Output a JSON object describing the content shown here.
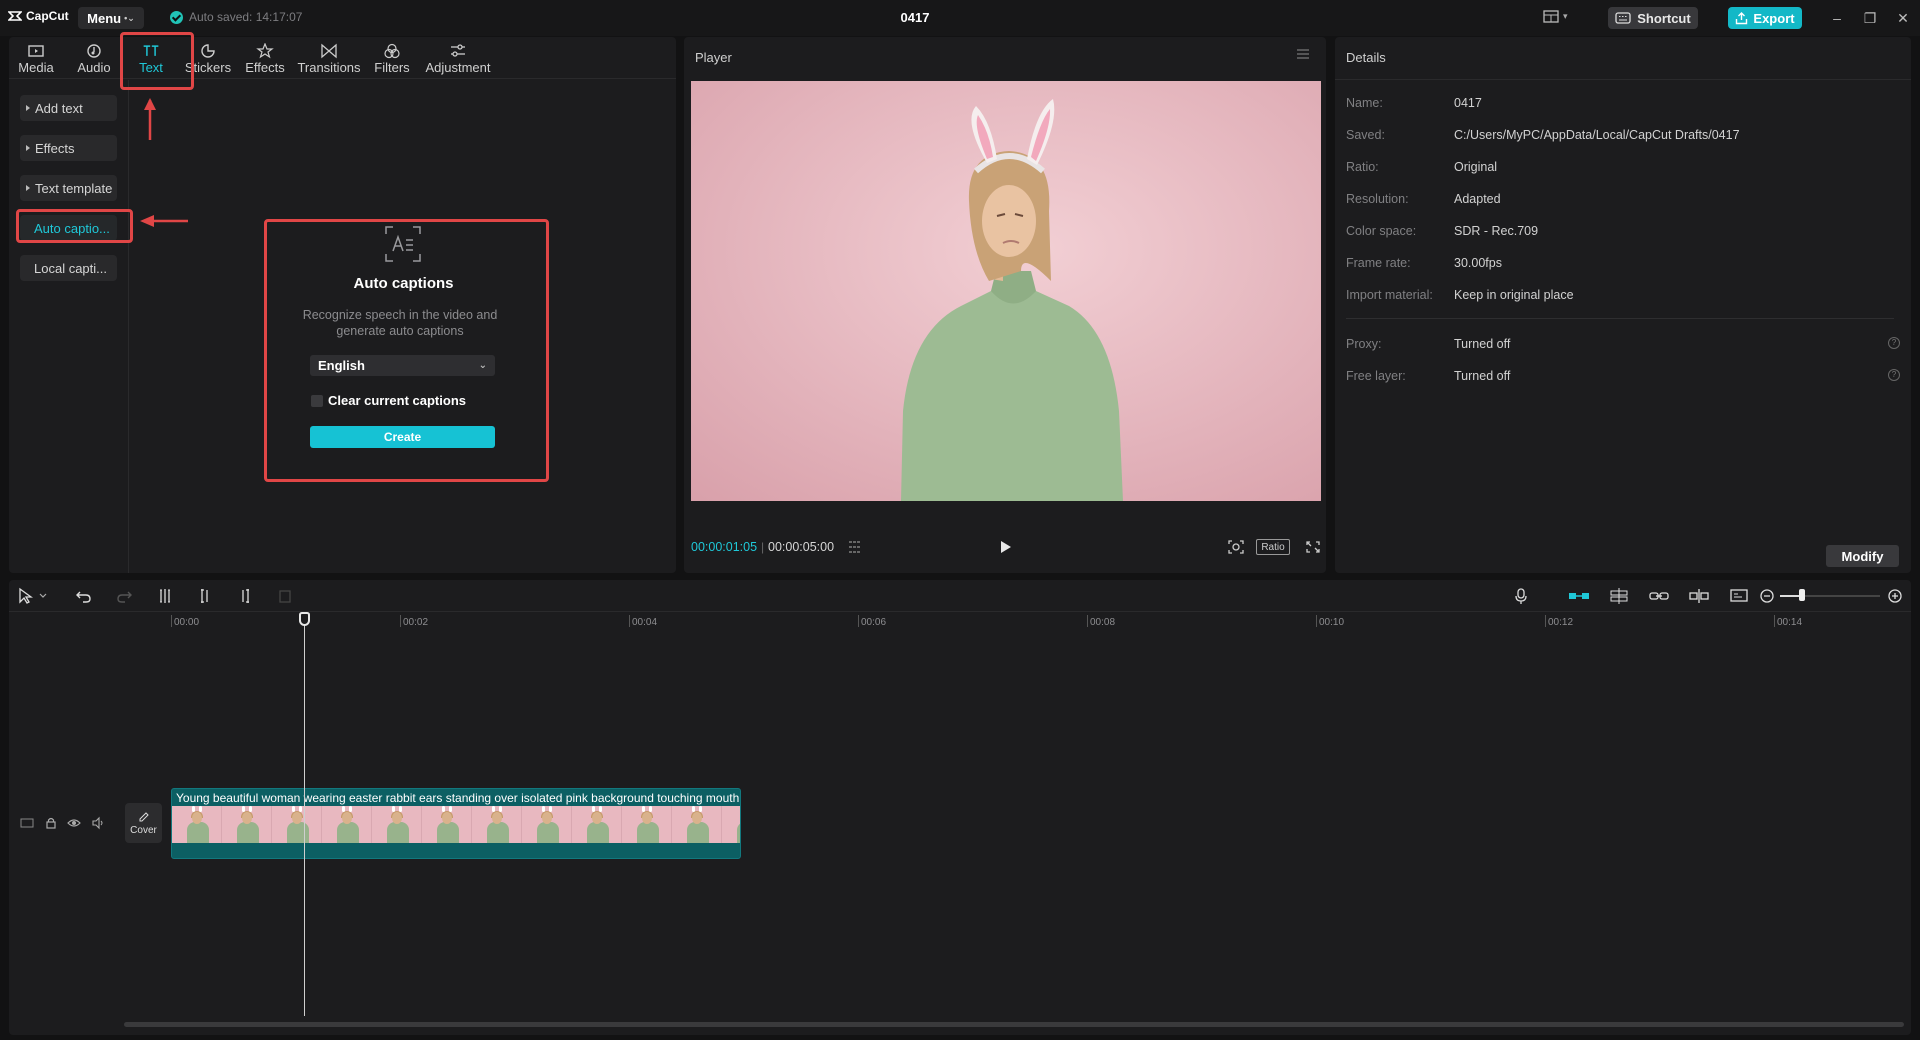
{
  "app": {
    "logo_text": "CapCut",
    "menu_label": "Menu",
    "autosave_text": "Auto saved: 14:17:07",
    "project_title": "0417",
    "shortcut_label": "Shortcut",
    "export_label": "Export"
  },
  "tabs": [
    {
      "label": "Media",
      "icon": "media-icon"
    },
    {
      "label": "Audio",
      "icon": "audio-icon"
    },
    {
      "label": "Text",
      "icon": "text-icon",
      "active": true
    },
    {
      "label": "Stickers",
      "icon": "stickers-icon"
    },
    {
      "label": "Effects",
      "icon": "effects-icon"
    },
    {
      "label": "Transitions",
      "icon": "transitions-icon"
    },
    {
      "label": "Filters",
      "icon": "filters-icon"
    },
    {
      "label": "Adjustment",
      "icon": "adjustment-icon"
    }
  ],
  "left_nav": [
    {
      "label": "Add text"
    },
    {
      "label": "Effects"
    },
    {
      "label": "Text template"
    },
    {
      "label": "Auto captio...",
      "active": true
    },
    {
      "label": "Local capti..."
    }
  ],
  "auto_captions": {
    "title": "Auto captions",
    "description": "Recognize speech in the video and generate auto captions",
    "language": "English",
    "clear_label": "Clear current captions",
    "create_label": "Create"
  },
  "player": {
    "title": "Player",
    "current_time": "00:00:01:05",
    "total_time": "00:00:05:00",
    "ratio_label": "Ratio"
  },
  "details": {
    "title": "Details",
    "rows": [
      {
        "label": "Name:",
        "value": "0417"
      },
      {
        "label": "Saved:",
        "value": "C:/Users/MyPC/AppData/Local/CapCut Drafts/0417"
      },
      {
        "label": "Ratio:",
        "value": "Original"
      },
      {
        "label": "Resolution:",
        "value": "Adapted"
      },
      {
        "label": "Color space:",
        "value": "SDR - Rec.709"
      },
      {
        "label": "Frame rate:",
        "value": "30.00fps"
      },
      {
        "label": "Import material:",
        "value": "Keep in original place"
      }
    ],
    "extra_rows": [
      {
        "label": "Proxy:",
        "value": "Turned off"
      },
      {
        "label": "Free layer:",
        "value": "Turned off"
      }
    ],
    "modify_label": "Modify"
  },
  "timeline": {
    "ticks": [
      "00:00",
      "00:02",
      "00:04",
      "00:06",
      "00:08",
      "00:10",
      "00:12",
      "00:14"
    ],
    "cover_label": "Cover",
    "clip_title": "Young beautiful woman wearing easter rabbit ears standing over isolated pink background touching mouth"
  },
  "colors": {
    "accent": "#1fc8d8",
    "annotation": "#e04646",
    "clip": "#0c5f63"
  }
}
